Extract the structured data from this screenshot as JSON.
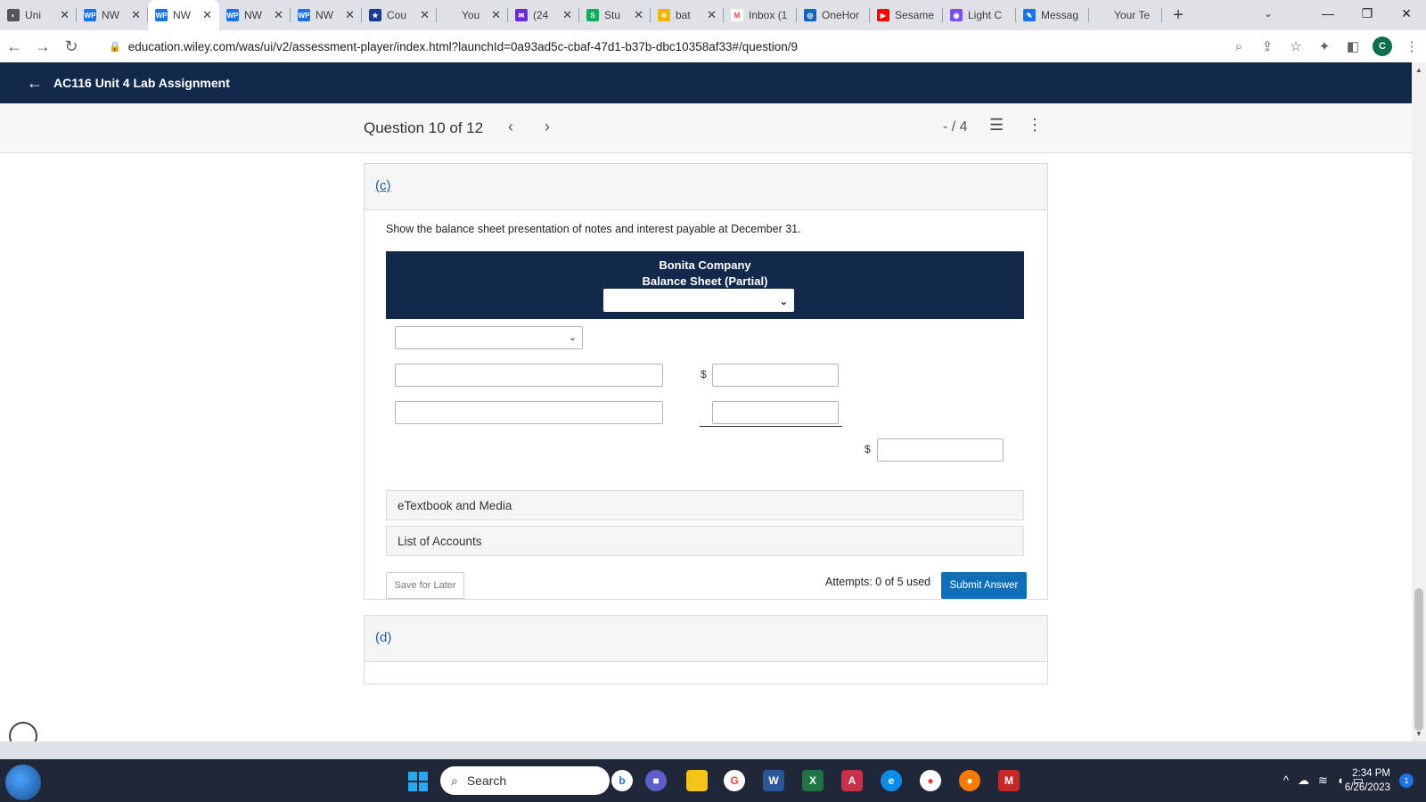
{
  "browser": {
    "tabs": [
      {
        "label": "Uni",
        "fav": "◐",
        "color": "#555555"
      },
      {
        "label": "NW",
        "fav": "WP",
        "color": "#1a73e8"
      },
      {
        "label": "NW",
        "fav": "WP",
        "color": "#1a73e8",
        "active": true
      },
      {
        "label": "NW",
        "fav": "WP",
        "color": "#1a73e8"
      },
      {
        "label": "NW",
        "fav": "WP",
        "color": "#1a73e8"
      },
      {
        "label": "Cou",
        "fav": "★",
        "color": "#1b3a8c"
      },
      {
        "label": "You",
        "fav": "",
        "color": "#dee1e6"
      },
      {
        "label": "(24",
        "fav": "✉",
        "color": "#6b2bd6"
      },
      {
        "label": "Stu",
        "fav": "S",
        "color": "#0fae5a"
      },
      {
        "label": "bat",
        "fav": "✳",
        "color": "#f4b400"
      },
      {
        "label": "Inbox (1",
        "fav": "M",
        "color": "#ffffff",
        "noclose": true
      },
      {
        "label": "OneHor",
        "fav": "◎",
        "color": "#1565c0",
        "noclose": true
      },
      {
        "label": "Sesame",
        "fav": "▶",
        "color": "#ff0000",
        "noclose": true
      },
      {
        "label": "Light C",
        "fav": "◉",
        "color": "#7c4dff",
        "noclose": true
      },
      {
        "label": "Messag",
        "fav": "✎",
        "color": "#1a73e8",
        "noclose": true
      },
      {
        "label": "Your Te",
        "fav": "",
        "color": "#dee1e6",
        "noclose": true
      }
    ],
    "url": "education.wiley.com/was/ui/v2/assessment-player/index.html?launchId=0a93ad5c-cbaf-47d1-b37b-dbc10358af33#/question/9",
    "profile_initial": "C"
  },
  "app": {
    "title": "AC116 Unit 4 Lab Assignment"
  },
  "question_bar": {
    "title": "Question 10 of 12",
    "score": "- / 4"
  },
  "part_c": {
    "label": "(c)",
    "prompt": "Show the balance sheet presentation of notes and interest payable at December 31.",
    "company": "Bonita Company",
    "statement": "Balance Sheet (Partial)",
    "currency": "$",
    "accordion": [
      "eTextbook and Media",
      "List of Accounts"
    ],
    "save_label": "Save for Later",
    "attempts": "Attempts: 0 of 5 used",
    "submit_label": "Submit Answer"
  },
  "part_d": {
    "label": "(d)"
  },
  "taskbar": {
    "search_label": "Search",
    "time": "2:34 PM",
    "date": "6/26/2023",
    "notifications": "1"
  }
}
